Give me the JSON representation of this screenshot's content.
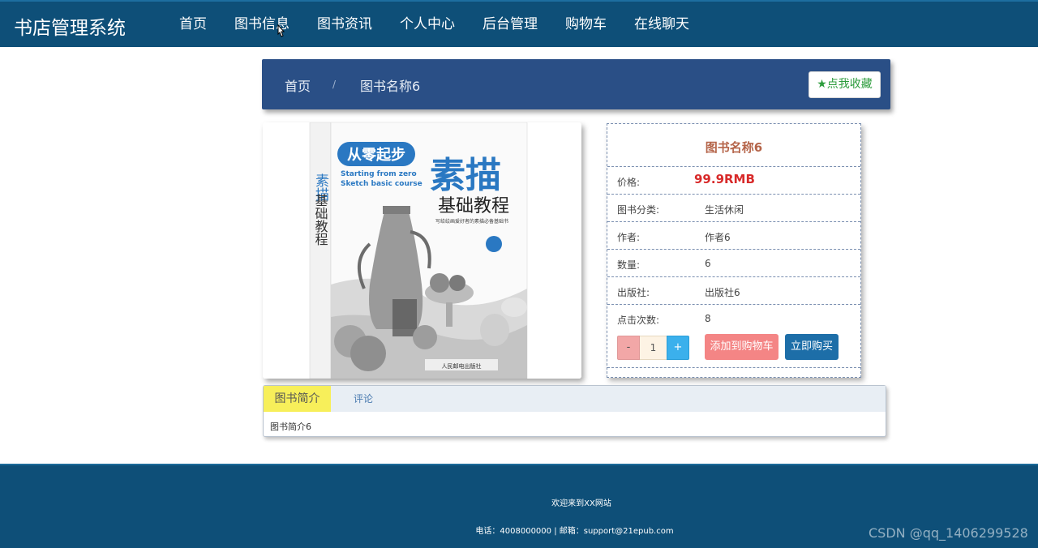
{
  "header": {
    "brand": "书店管理系统",
    "nav": [
      "首页",
      "图书信息",
      "图书资讯",
      "个人中心",
      "后台管理",
      "购物车",
      "在线聊天"
    ],
    "active_index": 1
  },
  "breadcrumb": {
    "home": "首页",
    "separator": "/",
    "current": "图书名称6",
    "favorite_label": "点我收藏"
  },
  "cover": {
    "series": "从零起步",
    "title": "素描",
    "subtitle": "基础教程",
    "english": "Starting from zero\nSketch basic course",
    "spine": "素描基础教程",
    "tagline": "写给绘画爱好者的素描必备基础书",
    "publisher": "人民邮电出版社"
  },
  "book": {
    "title": "图书名称6",
    "rows": [
      {
        "key": "价格:",
        "value": "99.9RMB",
        "is_price": true
      },
      {
        "key": "图书分类:",
        "value": "生活休闲"
      },
      {
        "key": "作者:",
        "value": "作者6"
      },
      {
        "key": "数量:",
        "value": "6"
      },
      {
        "key": "出版社:",
        "value": "出版社6"
      },
      {
        "key": "点击次数:",
        "value": "8"
      }
    ]
  },
  "purchase": {
    "minus": "-",
    "quantity": "1",
    "plus": "+",
    "add_to_cart": "添加到购物车",
    "buy_now": "立即购买"
  },
  "tabs": {
    "items": [
      "图书简介",
      "评论"
    ],
    "active_index": 0,
    "content": "图书简介6"
  },
  "footer": {
    "welcome": "欢迎来到XX网站",
    "contact": "电话：4008000000 | 邮箱：support@21epub.com",
    "watermark": "CSDN @qq_1406299528"
  },
  "colors": {
    "nav_bg": "#0e4f78",
    "breadcrumb_bg": "#2a4f86",
    "price": "#d82a2a",
    "title": "#b5654a",
    "cart_button": "#f48585",
    "buy_button": "#1d6ea8",
    "active_tab": "#f7ef5a"
  }
}
